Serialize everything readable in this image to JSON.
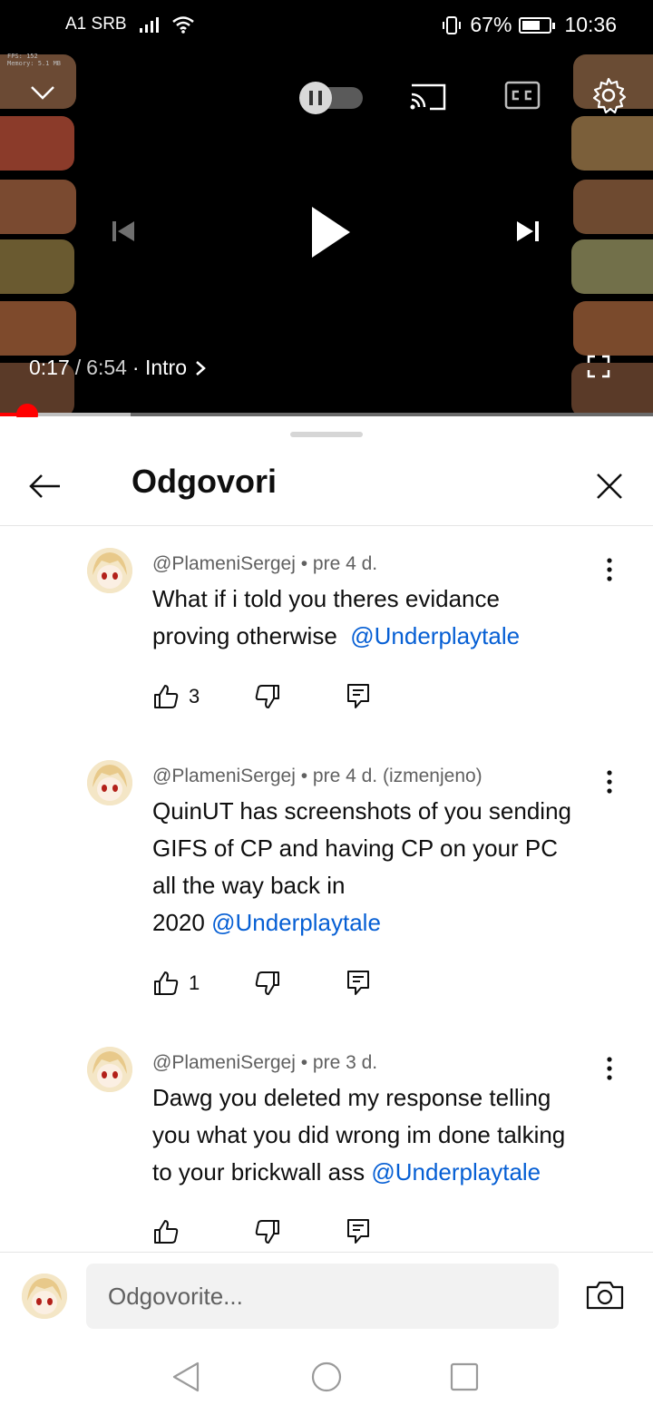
{
  "status_bar": {
    "carrier": "A1 SRB",
    "battery_percent": "67%",
    "battery_level": 0.67,
    "time": "10:36"
  },
  "player": {
    "debug_overlay": [
      "FPS: 152",
      "Memory: 5.1 MB"
    ],
    "current_time": "0:17",
    "separator": "/",
    "duration": "6:54",
    "chapter": "· Intro",
    "progress_fraction": 0.041,
    "buffered_fraction": 0.2,
    "autoplay_toggle_on": false
  },
  "sheet": {
    "title": "Odgovori"
  },
  "comments": [
    {
      "author": "@PlameniSergej",
      "age": "• pre 4 d.",
      "lines": [
        "What if i told you theres evidance",
        "proving otherwise"
      ],
      "mention": "@Underplaytale",
      "likes": "3"
    },
    {
      "author": "@PlameniSergej",
      "age": "• pre 4 d. (izmenjeno)",
      "lines": [
        "QuinUT has screenshots of you sending",
        "GIFS of CP and having CP on your PC",
        "all the way back in",
        "2020"
      ],
      "mention": "@Underplaytale",
      "likes": "1"
    },
    {
      "author": "@PlameniSergej",
      "age": "• pre 3 d.",
      "lines": [
        "Dawg you deleted my response telling",
        "you what you did wrong im done talking",
        "to your brickwall ass"
      ],
      "mention": "@Underplaytale",
      "likes": ""
    }
  ],
  "reply": {
    "placeholder": "Odgovorite..."
  },
  "colors": {
    "accent_red": "#ff0000",
    "mention_blue": "#065fd4"
  }
}
